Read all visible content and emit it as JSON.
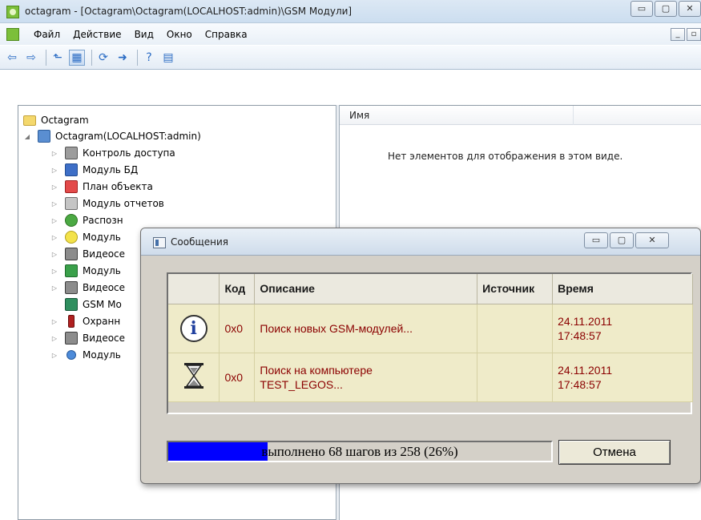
{
  "window": {
    "title": "octagram - [Octagram\\Octagram(LOCALHOST:admin)\\GSM Модули]",
    "controls": [
      "▭",
      "▢",
      "✕"
    ]
  },
  "menu": {
    "items": [
      "Файл",
      "Действие",
      "Вид",
      "Окно",
      "Справка"
    ],
    "child_controls": [
      "_",
      "▫"
    ]
  },
  "toolbar": {
    "buttons": [
      {
        "icon": "back-arrow-icon",
        "glyph": "⇦"
      },
      {
        "icon": "forward-arrow-icon",
        "glyph": "⇨"
      },
      {
        "icon": "up-folder-icon",
        "glyph": "⬑"
      },
      {
        "icon": "show-tree-icon",
        "glyph": "▦"
      },
      {
        "icon": "refresh-icon",
        "glyph": "⟳"
      },
      {
        "icon": "export-icon",
        "glyph": "➜"
      },
      {
        "icon": "help-icon",
        "glyph": "?"
      },
      {
        "icon": "properties-icon",
        "glyph": "▤"
      }
    ]
  },
  "tree": {
    "root": "Octagram",
    "server": "Octagram(LOCALHOST:admin)",
    "items": [
      {
        "label": "Контроль доступа",
        "icon": "lock-icon"
      },
      {
        "label": "Модуль БД",
        "icon": "database-icon"
      },
      {
        "label": "План объекта",
        "icon": "plan-icon"
      },
      {
        "label": "Модуль отчетов",
        "icon": "report-icon"
      },
      {
        "label": "Распозн",
        "icon": "recognition-icon"
      },
      {
        "label": "Модуль",
        "icon": "weather-icon"
      },
      {
        "label": "Видеосе",
        "icon": "camera-icon"
      },
      {
        "label": "Модуль",
        "icon": "module-icon"
      },
      {
        "label": "Видеосе",
        "icon": "camera-icon"
      },
      {
        "label": "GSM Mo",
        "icon": "gsm-icon"
      },
      {
        "label": "Охранн",
        "icon": "alarm-icon"
      },
      {
        "label": "Видеосе",
        "icon": "camera-icon"
      },
      {
        "label": "Модуль",
        "icon": "person-icon"
      }
    ]
  },
  "list": {
    "columns": [
      "Имя",
      ""
    ],
    "empty_message": "Нет элементов для отображения в этом виде."
  },
  "dialog": {
    "title": "Сообщения",
    "controls": [
      "▭",
      "▢",
      "✕"
    ],
    "table": {
      "headers": [
        "",
        "Код",
        "Описание",
        "Источник",
        "Время"
      ],
      "rows": [
        {
          "icon": "info-icon",
          "code": "0x0",
          "description": "Поиск новых GSM-модулей...",
          "source": "",
          "time_date": "24.11.2011",
          "time_clock": "17:48:57"
        },
        {
          "icon": "hourglass-icon",
          "code": "0x0",
          "description_line1": "Поиск на компьютере",
          "description_line2": "TEST_LEGOS...",
          "source": "",
          "time_date": "24.11.2011",
          "time_clock": "17:48:57"
        }
      ]
    },
    "progress": {
      "text": "выполнено 68 шагов из 258 (26%)",
      "fraction": 0.26,
      "fill_color": "#0000ff"
    },
    "cancel_label": "Отмена"
  },
  "colors": {
    "message_row_bg": "#efebc9",
    "message_text": "#8b0000",
    "dialog_bg": "#d4d0c8"
  }
}
